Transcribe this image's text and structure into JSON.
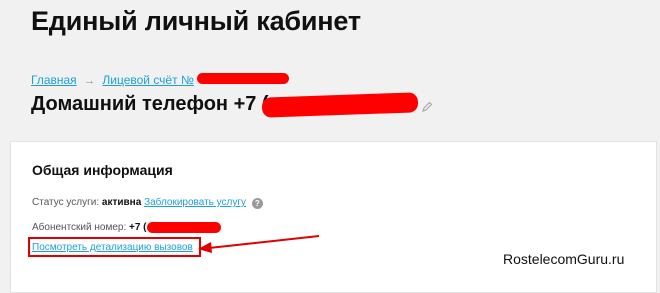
{
  "header": {
    "title": "Единый личный кабинет"
  },
  "breadcrumb": {
    "home": "Главная",
    "account": "Лицевой счёт №"
  },
  "service": {
    "title": "Домашний телефон +7 ("
  },
  "info": {
    "title": "Общая информация",
    "status_label": "Статус услуги:",
    "status_value": "активна",
    "block_link": "Заблокировать услугу",
    "help_glyph": "?",
    "subscriber_label": "Абонентский номер:",
    "subscriber_value": "+7 (",
    "details_link": "Посмотреть детализацию вызовов"
  },
  "watermark": "RostelecomGuru.ru",
  "colors": {
    "link": "#1d9fd9",
    "redaction": "#ff0000",
    "highlight": "#e00000"
  }
}
